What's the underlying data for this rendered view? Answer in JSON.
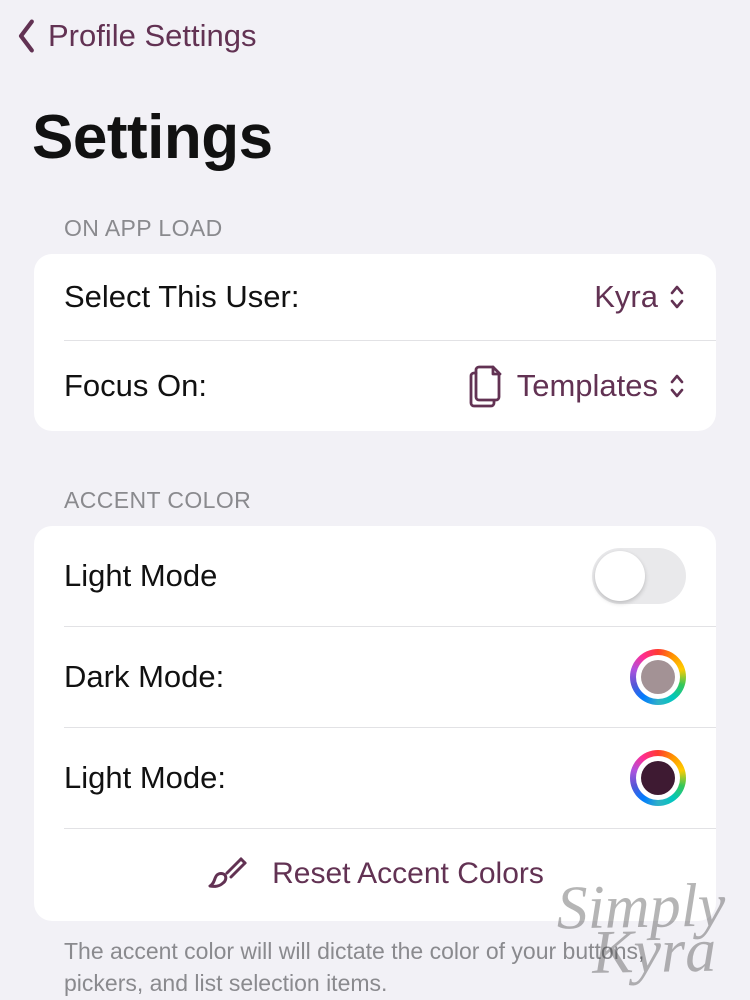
{
  "header": {
    "breadcrumb": "Profile Settings"
  },
  "title": "Settings",
  "sections": {
    "onLoad": {
      "header": "ON APP LOAD",
      "rows": {
        "selectUser": {
          "label": "Select This User:",
          "value": "Kyra"
        },
        "focusOn": {
          "label": "Focus On:",
          "value": "Templates"
        }
      }
    },
    "accent": {
      "header": "ACCENT COLOR",
      "rows": {
        "lightModeToggle": {
          "label": "Light Mode",
          "on": false
        },
        "darkMode": {
          "label": "Dark Mode:",
          "swatch": "#a39295"
        },
        "lightMode": {
          "label": "Light Mode:",
          "swatch": "#3e1a32"
        },
        "reset": {
          "label": "Reset Accent Colors"
        }
      },
      "footer": "The accent color will will dictate the color of your buttons, pickers, and list selection items."
    }
  },
  "watermark": {
    "line1": "Simply",
    "line2": "Kyra"
  },
  "colors": {
    "accent": "#623253"
  }
}
